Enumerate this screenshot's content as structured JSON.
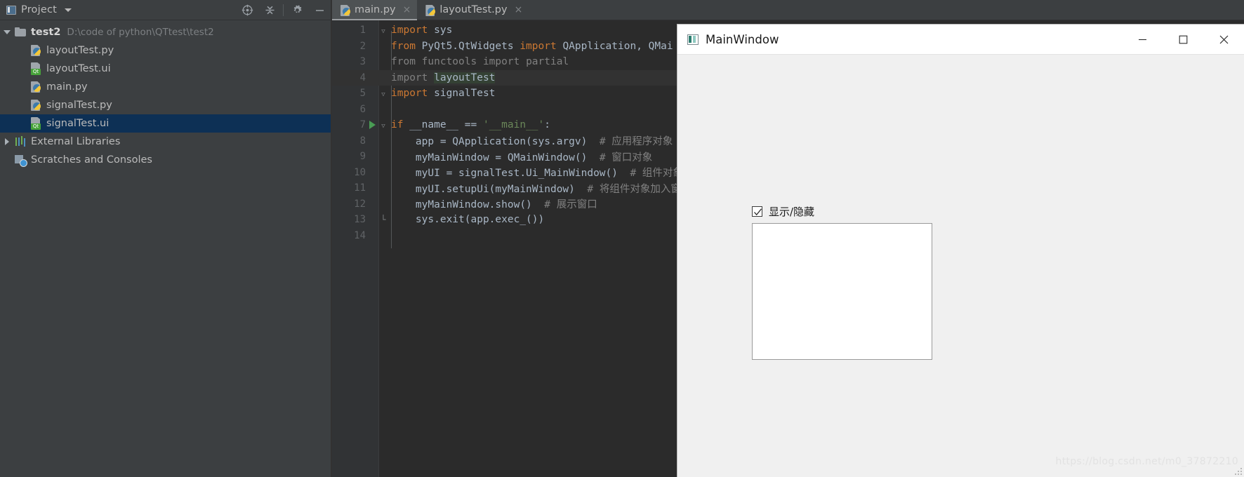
{
  "ide": {
    "project_panel": {
      "title": "Project",
      "icon": "project-window-icon",
      "caret": "chevron-down-icon",
      "tools": [
        {
          "name": "locate-icon",
          "label": "Select Opened File"
        },
        {
          "name": "collapse-all-icon",
          "label": "Collapse All"
        },
        {
          "name": "gear-icon",
          "label": "Settings"
        },
        {
          "name": "minimize-icon",
          "label": "Hide"
        }
      ]
    },
    "tree": [
      {
        "label": "test2",
        "path": "D:\\code of python\\QTtest\\test2",
        "icon": "folder-icon",
        "twisty": "triangle-down",
        "depth": 0,
        "bold": true,
        "selected": false
      },
      {
        "label": "layoutTest.py",
        "path": "",
        "icon": "python-file-icon",
        "twisty": "",
        "depth": 1,
        "bold": false,
        "selected": false
      },
      {
        "label": "layoutTest.ui",
        "path": "",
        "icon": "qt-ui-file-icon",
        "twisty": "",
        "depth": 1,
        "bold": false,
        "selected": false
      },
      {
        "label": "main.py",
        "path": "",
        "icon": "python-file-icon",
        "twisty": "",
        "depth": 1,
        "bold": false,
        "selected": false
      },
      {
        "label": "signalTest.py",
        "path": "",
        "icon": "python-file-icon",
        "twisty": "",
        "depth": 1,
        "bold": false,
        "selected": false
      },
      {
        "label": "signalTest.ui",
        "path": "",
        "icon": "qt-ui-file-icon",
        "twisty": "",
        "depth": 1,
        "bold": false,
        "selected": true
      },
      {
        "label": "External Libraries",
        "path": "",
        "icon": "libraries-icon",
        "twisty": "triangle-right",
        "depth": 0,
        "bold": false,
        "selected": false
      },
      {
        "label": "Scratches and Consoles",
        "path": "",
        "icon": "scratches-icon",
        "twisty": "",
        "depth": 0,
        "bold": false,
        "selected": false
      }
    ],
    "tabs": [
      {
        "label": "main.py",
        "icon": "python-file-icon",
        "active": true,
        "close": "×"
      },
      {
        "label": "layoutTest.py",
        "icon": "python-file-icon",
        "active": false,
        "close": "×"
      }
    ],
    "editor": {
      "file": "main.py",
      "lines": [
        {
          "n": "1",
          "run": false,
          "fold": "top",
          "highlight": false,
          "tokens": [
            {
              "t": "import",
              "c": "kw"
            },
            {
              "t": " sys",
              "c": "ident"
            }
          ]
        },
        {
          "n": "2",
          "run": false,
          "fold": "",
          "highlight": false,
          "tokens": [
            {
              "t": "from",
              "c": "kw"
            },
            {
              "t": " PyQt5.QtWidgets ",
              "c": "ident"
            },
            {
              "t": "import",
              "c": "kw"
            },
            {
              "t": " QApplication, QMai",
              "c": "ident"
            }
          ]
        },
        {
          "n": "3",
          "run": false,
          "fold": "",
          "highlight": false,
          "tokens": [
            {
              "t": "from",
              "c": "cm"
            },
            {
              "t": " functools ",
              "c": "cm"
            },
            {
              "t": "import",
              "c": "cm"
            },
            {
              "t": " partial",
              "c": "cm"
            }
          ]
        },
        {
          "n": "4",
          "run": false,
          "fold": "",
          "highlight": true,
          "tokens": [
            {
              "t": "import",
              "c": "cm"
            },
            {
              "t": " ",
              "c": "cm"
            },
            {
              "t": "layoutTest",
              "c": "hl-ident"
            }
          ]
        },
        {
          "n": "5",
          "run": false,
          "fold": "top",
          "highlight": false,
          "tokens": [
            {
              "t": "import",
              "c": "kw"
            },
            {
              "t": " signalTest",
              "c": "ident"
            }
          ]
        },
        {
          "n": "6",
          "run": false,
          "fold": "",
          "highlight": false,
          "tokens": []
        },
        {
          "n": "7",
          "run": true,
          "fold": "top",
          "highlight": false,
          "tokens": [
            {
              "t": "if",
              "c": "kw"
            },
            {
              "t": " __name__ == ",
              "c": "ident"
            },
            {
              "t": "'__main__'",
              "c": "str"
            },
            {
              "t": ":",
              "c": "ident"
            }
          ]
        },
        {
          "n": "8",
          "run": false,
          "fold": "",
          "highlight": false,
          "tokens": [
            {
              "t": "    app = QApplication(sys.argv)  ",
              "c": "ident"
            },
            {
              "t": "# 应用程序对象",
              "c": "cm"
            }
          ]
        },
        {
          "n": "9",
          "run": false,
          "fold": "",
          "highlight": false,
          "tokens": [
            {
              "t": "    myMainWindow = QMainWindow()  ",
              "c": "ident"
            },
            {
              "t": "# 窗口对象",
              "c": "cm"
            }
          ]
        },
        {
          "n": "10",
          "run": false,
          "fold": "",
          "highlight": false,
          "tokens": [
            {
              "t": "    myUI = signalTest.Ui_MainWindow()  ",
              "c": "ident"
            },
            {
              "t": "# 组件对象",
              "c": "cm"
            }
          ]
        },
        {
          "n": "11",
          "run": false,
          "fold": "",
          "highlight": false,
          "tokens": [
            {
              "t": "    myUI.setupUi(myMainWindow)  ",
              "c": "ident"
            },
            {
              "t": "# 将组件对象加入窗口",
              "c": "cm"
            }
          ]
        },
        {
          "n": "12",
          "run": false,
          "fold": "",
          "highlight": false,
          "tokens": [
            {
              "t": "    myMainWindow.show()  ",
              "c": "ident"
            },
            {
              "t": "# 展示窗口",
              "c": "cm"
            }
          ]
        },
        {
          "n": "13",
          "run": false,
          "fold": "bot",
          "highlight": false,
          "tokens": [
            {
              "t": "    sys.exit(app.exec_())",
              "c": "ident"
            }
          ]
        },
        {
          "n": "14",
          "run": false,
          "fold": "",
          "highlight": false,
          "tokens": []
        }
      ]
    }
  },
  "qt_window": {
    "title": "MainWindow",
    "app_icon": "qt-app-icon",
    "window_buttons": [
      {
        "name": "minimize-button",
        "glyph": "minimize-icon"
      },
      {
        "name": "maximize-button",
        "glyph": "maximize-icon"
      },
      {
        "name": "close-button",
        "glyph": "close-icon"
      }
    ],
    "checkbox": {
      "label": "显示/隐藏",
      "checked": true
    },
    "textedit": {
      "value": "",
      "placeholder": ""
    },
    "watermark": "https://blog.csdn.net/m0_37872210"
  },
  "colors": {
    "ide_chrome": "#3c3f41",
    "editor_bg": "#2b2b2b",
    "gutter_bg": "#313335",
    "selection_blue": "#0d3055",
    "keyword_orange": "#cc7832",
    "string_green": "#6a8759",
    "comment_gray": "#808080",
    "text_default": "#a9b7c6",
    "qt_body": "#f0f0f0",
    "qt_titlebar": "#ffffff"
  }
}
